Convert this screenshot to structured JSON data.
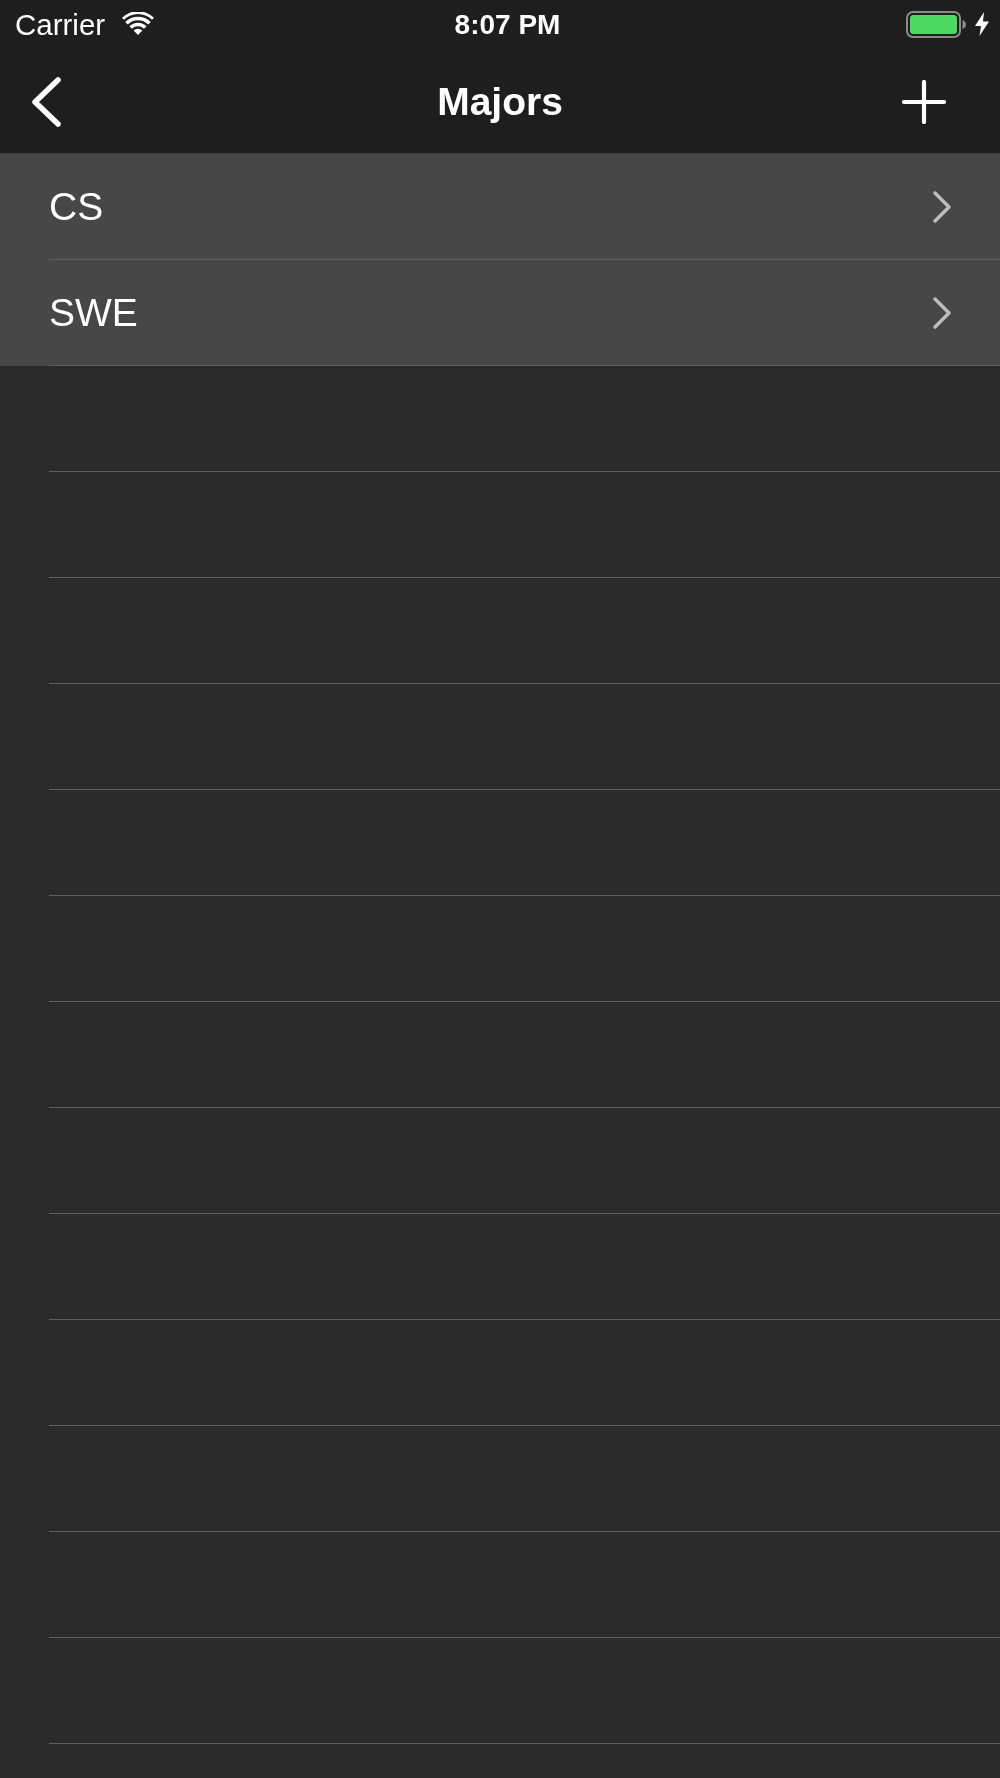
{
  "status_bar": {
    "carrier": "Carrier",
    "time": "8:07 PM"
  },
  "nav_bar": {
    "title": "Majors"
  },
  "majors": [
    {
      "name": "CS"
    },
    {
      "name": "SWE"
    }
  ]
}
